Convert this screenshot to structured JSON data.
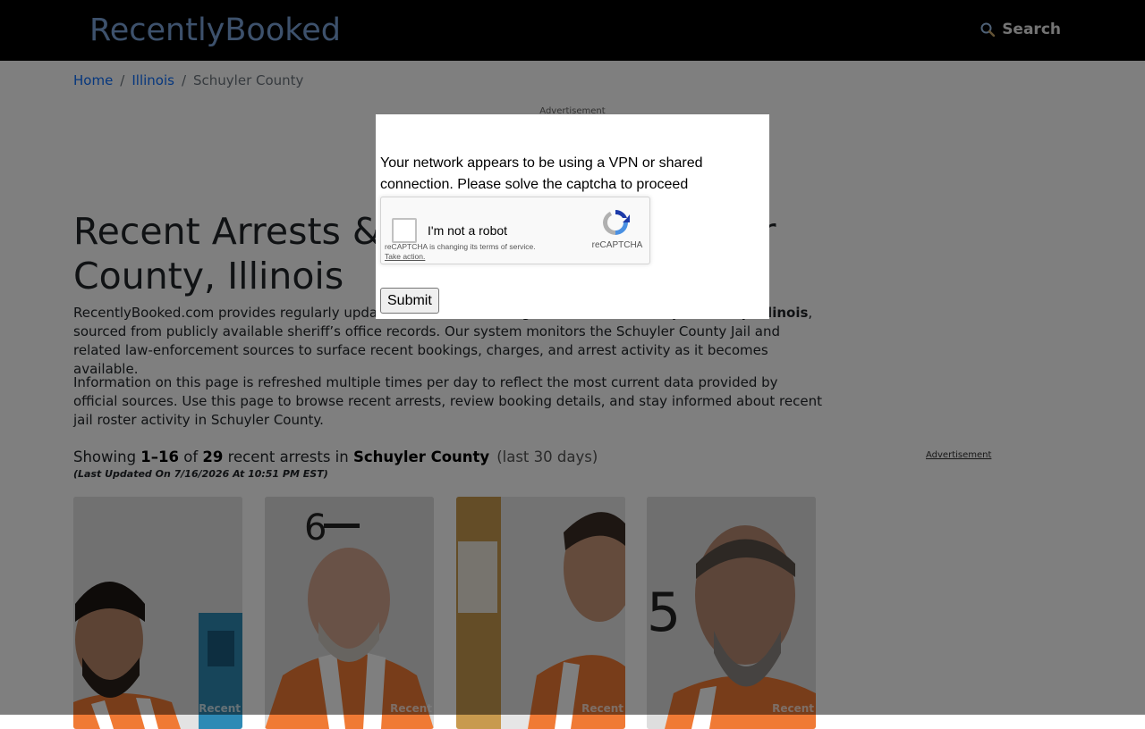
{
  "header": {
    "brand": "RecentlyBooked",
    "search_label": "Search"
  },
  "breadcrumb": {
    "items": [
      {
        "label": "Home"
      },
      {
        "label": "Illinois"
      },
      {
        "label": "Schuyler County"
      }
    ],
    "separator": "/"
  },
  "ads": {
    "top_label": "Advertisement",
    "side_label": "Advertisement"
  },
  "main": {
    "title": "Recent Arrests & Bookings in Schuyler County, Illinois",
    "intro_1_pre": "RecentlyBooked.com provides regularly updated arrest and booking information for Schuyler County, ",
    "intro_1_bold": "Illinois",
    "intro_1_post": ", sourced from publicly available sheriff’s office records. Our system monitors the Schuyler County Jail and related law-enforcement sources to surface recent bookings, charges, and arrest activity as it becomes available.",
    "intro_2": "Information on this page is refreshed multiple times per day to reflect the most current data provided by official sources. Use this page to browse recent arrests, review booking details, and stay informed about recent jail roster activity in Schuyler County.",
    "showing_prefix": "Showing ",
    "showing_range": "1–16",
    "showing_of": " of ",
    "showing_total": "29",
    "showing_mid": " recent arrests in ",
    "showing_county": "Schuyler County",
    "showing_period": "(last 30 days)",
    "last_updated": "(Last Updated On 7/16/2026 At 10:51 PM EST)",
    "card_watermark": "Recent"
  },
  "modal": {
    "message": "Your network appears to be using a VPN or shared connection. Please solve the captcha to proceed",
    "recaptcha_label": "I'm not a robot",
    "recaptcha_brand": "reCAPTCHA",
    "recaptcha_terms": "reCAPTCHA is changing its terms of service.",
    "recaptcha_action": "Take action.",
    "submit_label": "Submit"
  },
  "colors": {
    "topbar": "#000000",
    "brand": "#7ba3d8",
    "link": "#0d6efd",
    "overlay": "rgba(0,0,0,0.5)"
  }
}
